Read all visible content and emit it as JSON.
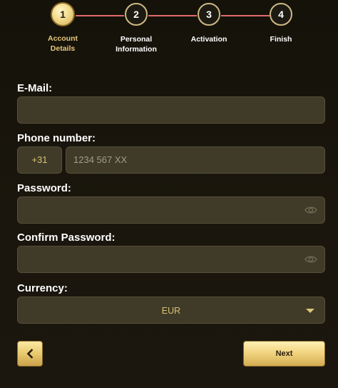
{
  "stepper": {
    "steps": [
      {
        "number": "1",
        "label": "Account Details",
        "active": true
      },
      {
        "number": "2",
        "label": "Personal Information",
        "active": false
      },
      {
        "number": "3",
        "label": "Activation",
        "active": false
      },
      {
        "number": "4",
        "label": "Finish",
        "active": false
      }
    ]
  },
  "form": {
    "email": {
      "label": "E-Mail:",
      "value": ""
    },
    "phone": {
      "label": "Phone number:",
      "prefix": "+31",
      "placeholder": "1234 567 XX"
    },
    "password": {
      "label": "Password:",
      "value": ""
    },
    "confirm_password": {
      "label": "Confirm Password:",
      "value": ""
    },
    "currency": {
      "label": "Currency:",
      "value": "EUR"
    }
  },
  "buttons": {
    "next_label": "Next"
  },
  "icons": {
    "password_toggle": "eye-icon",
    "back": "chevron-left-icon",
    "dropdown": "caret-down-icon"
  },
  "colors": {
    "accent_gold": "#e8c77a",
    "step_line": "#e06a6a",
    "field_bg": "#403a28"
  }
}
